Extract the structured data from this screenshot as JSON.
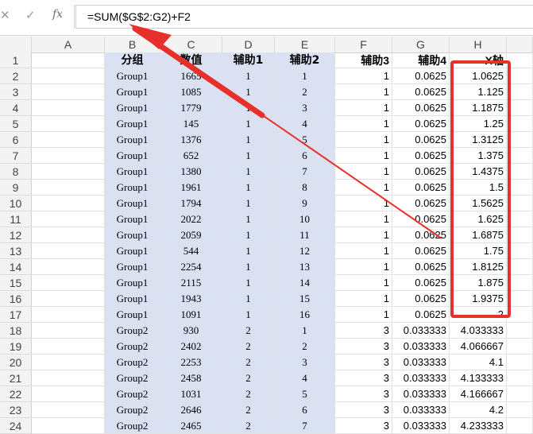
{
  "formula_bar": {
    "cancel_icon": "✕",
    "enter_icon": "✓",
    "fx_label": "fx",
    "formula": "=SUM($G$2:G2)+F2"
  },
  "columns": [
    "A",
    "B",
    "C",
    "D",
    "E",
    "F",
    "G",
    "H"
  ],
  "rows": [
    {
      "n": "1",
      "A": "",
      "B": "分组",
      "C": "数值",
      "D": "辅助1",
      "E": "辅助2",
      "F": "辅助3",
      "G": "辅助4",
      "H": "X轴"
    },
    {
      "n": "2",
      "A": "",
      "B": "Group1",
      "C": "1665",
      "D": "1",
      "E": "1",
      "F": "1",
      "G": "0.0625",
      "H": "1.0625"
    },
    {
      "n": "3",
      "A": "",
      "B": "Group1",
      "C": "1085",
      "D": "1",
      "E": "2",
      "F": "1",
      "G": "0.0625",
      "H": "1.125"
    },
    {
      "n": "4",
      "A": "",
      "B": "Group1",
      "C": "1779",
      "D": "1",
      "E": "3",
      "F": "1",
      "G": "0.0625",
      "H": "1.1875"
    },
    {
      "n": "5",
      "A": "",
      "B": "Group1",
      "C": "145",
      "D": "1",
      "E": "4",
      "F": "1",
      "G": "0.0625",
      "H": "1.25"
    },
    {
      "n": "6",
      "A": "",
      "B": "Group1",
      "C": "1376",
      "D": "1",
      "E": "5",
      "F": "1",
      "G": "0.0625",
      "H": "1.3125"
    },
    {
      "n": "7",
      "A": "",
      "B": "Group1",
      "C": "652",
      "D": "1",
      "E": "6",
      "F": "1",
      "G": "0.0625",
      "H": "1.375"
    },
    {
      "n": "8",
      "A": "",
      "B": "Group1",
      "C": "1380",
      "D": "1",
      "E": "7",
      "F": "1",
      "G": "0.0625",
      "H": "1.4375"
    },
    {
      "n": "9",
      "A": "",
      "B": "Group1",
      "C": "1961",
      "D": "1",
      "E": "8",
      "F": "1",
      "G": "0.0625",
      "H": "1.5"
    },
    {
      "n": "10",
      "A": "",
      "B": "Group1",
      "C": "1794",
      "D": "1",
      "E": "9",
      "F": "1",
      "G": "0.0625",
      "H": "1.5625"
    },
    {
      "n": "11",
      "A": "",
      "B": "Group1",
      "C": "2022",
      "D": "1",
      "E": "10",
      "F": "1",
      "G": "0.0625",
      "H": "1.625"
    },
    {
      "n": "12",
      "A": "",
      "B": "Group1",
      "C": "2059",
      "D": "1",
      "E": "11",
      "F": "1",
      "G": "0.0625",
      "H": "1.6875"
    },
    {
      "n": "13",
      "A": "",
      "B": "Group1",
      "C": "544",
      "D": "1",
      "E": "12",
      "F": "1",
      "G": "0.0625",
      "H": "1.75"
    },
    {
      "n": "14",
      "A": "",
      "B": "Group1",
      "C": "2254",
      "D": "1",
      "E": "13",
      "F": "1",
      "G": "0.0625",
      "H": "1.8125"
    },
    {
      "n": "15",
      "A": "",
      "B": "Group1",
      "C": "2115",
      "D": "1",
      "E": "14",
      "F": "1",
      "G": "0.0625",
      "H": "1.875"
    },
    {
      "n": "16",
      "A": "",
      "B": "Group1",
      "C": "1943",
      "D": "1",
      "E": "15",
      "F": "1",
      "G": "0.0625",
      "H": "1.9375"
    },
    {
      "n": "17",
      "A": "",
      "B": "Group1",
      "C": "1091",
      "D": "1",
      "E": "16",
      "F": "1",
      "G": "0.0625",
      "H": "2"
    },
    {
      "n": "18",
      "A": "",
      "B": "Group2",
      "C": "930",
      "D": "2",
      "E": "1",
      "F": "3",
      "G": "0.033333",
      "H": "4.033333"
    },
    {
      "n": "19",
      "A": "",
      "B": "Group2",
      "C": "2402",
      "D": "2",
      "E": "2",
      "F": "3",
      "G": "0.033333",
      "H": "4.066667"
    },
    {
      "n": "20",
      "A": "",
      "B": "Group2",
      "C": "2253",
      "D": "2",
      "E": "3",
      "F": "3",
      "G": "0.033333",
      "H": "4.1"
    },
    {
      "n": "21",
      "A": "",
      "B": "Group2",
      "C": "2458",
      "D": "2",
      "E": "4",
      "F": "3",
      "G": "0.033333",
      "H": "4.133333"
    },
    {
      "n": "22",
      "A": "",
      "B": "Group2",
      "C": "1031",
      "D": "2",
      "E": "5",
      "F": "3",
      "G": "0.033333",
      "H": "4.166667"
    },
    {
      "n": "23",
      "A": "",
      "B": "Group2",
      "C": "2646",
      "D": "2",
      "E": "6",
      "F": "3",
      "G": "0.033333",
      "H": "4.2"
    },
    {
      "n": "24",
      "A": "",
      "B": "Group2",
      "C": "2465",
      "D": "2",
      "E": "7",
      "F": "3",
      "G": "0.033333",
      "H": "4.233333"
    }
  ],
  "annotation_color": "#e8302a",
  "band_color": "#d9e1f2"
}
